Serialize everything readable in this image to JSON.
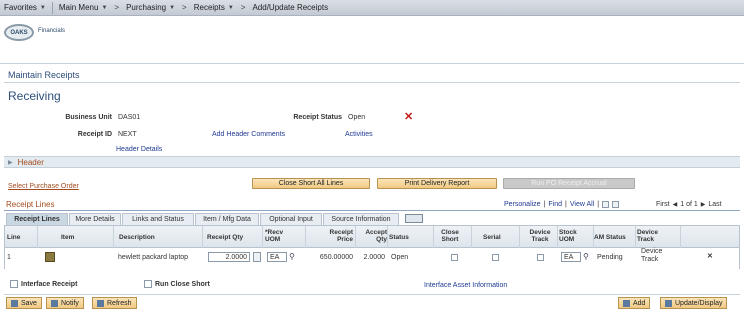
{
  "nav": {
    "favorites": "Favorites",
    "main_menu": "Main Menu",
    "purchasing": "Purchasing",
    "receipts": "Receipts",
    "current": "Add/Update Receipts",
    "separator": ">"
  },
  "logo": {
    "oval": "OAKS",
    "text": "Financials"
  },
  "section_title": "Maintain Receipts",
  "page_title": "Receiving",
  "fields": {
    "business_unit_label": "Business Unit",
    "business_unit_value": "DAS01",
    "receipt_status_label": "Receipt Status",
    "receipt_status_value": "Open",
    "receipt_id_label": "Receipt ID",
    "receipt_id_value": "NEXT",
    "add_header_comments": "Add Header Comments",
    "activities": "Activities",
    "header_details": "Header Details"
  },
  "header_section": "Header",
  "select_purchase_order": "Select Purchase Order",
  "buttons": {
    "close_short": "Close Short All Lines",
    "print_delivery": "Print Delivery Report",
    "run_po_accrual": "Run PO Receipt Accrual"
  },
  "grid": {
    "title": "Receipt Lines",
    "personalize": "Personalize",
    "find": "Find",
    "view_all": "View All",
    "first": "First",
    "range": "1 of 1",
    "last": "Last",
    "tabs": [
      "Receipt Lines",
      "More Details",
      "Links and Status",
      "Item / Mfg Data",
      "Optional Input",
      "Source Information"
    ],
    "headers": {
      "line": "Line",
      "item": "Item",
      "description": "Description",
      "receipt_qty": "Receipt Qty",
      "recv_uom": "*Recv UOM",
      "receipt_price": "Receipt Price",
      "accept_qty": "Accept Qty",
      "status": "Status",
      "close_short": "Close Short",
      "serial": "Serial",
      "device_track": "Device Track",
      "stock_uom": "Stock UOM",
      "am_status": "AM Status",
      "device_track2": "Device Track"
    },
    "row": {
      "line": "1",
      "description": "hewlett packard laptop",
      "receipt_qty": "2.0000",
      "recv_uom": "EA",
      "receipt_price": "650.00000",
      "accept_qty": "2.0000",
      "status": "Open",
      "stock_uom": "EA",
      "am_status": "Pending",
      "device_track": "Device Track"
    }
  },
  "footer": {
    "interface_receipt": "Interface Receipt",
    "run_close_short": "Run Close Short",
    "interface_asset": "Interface Asset Information",
    "save": "Save",
    "notify": "Notify",
    "refresh": "Refresh",
    "add": "Add",
    "update_display": "Update/Display"
  }
}
